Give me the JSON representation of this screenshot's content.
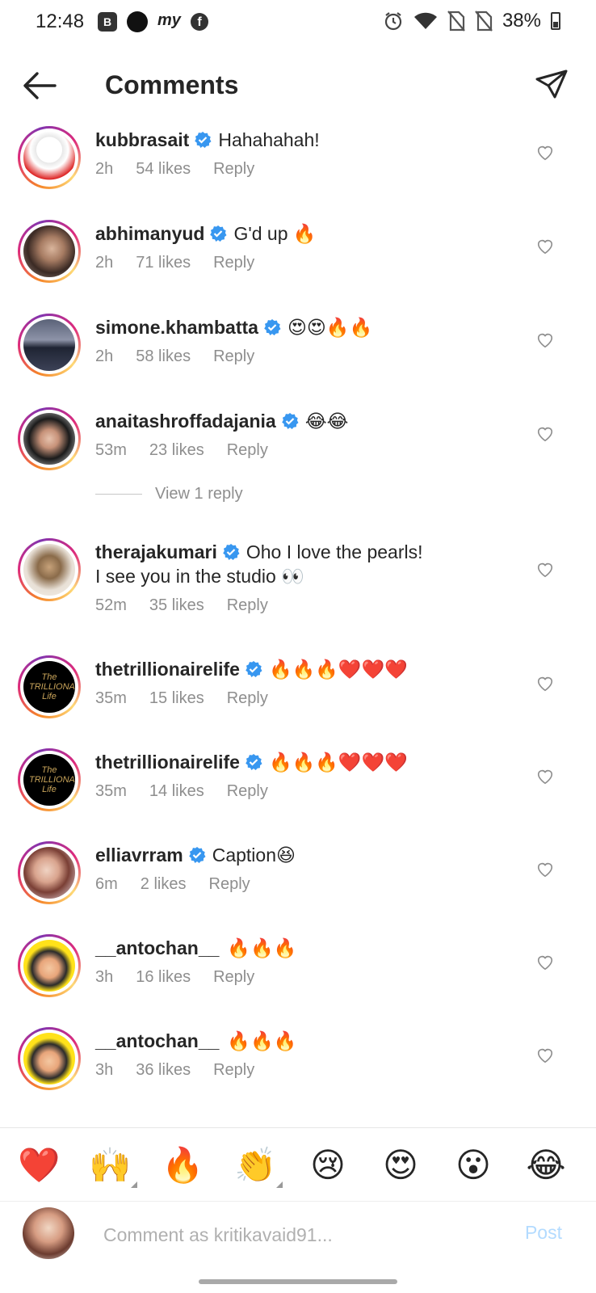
{
  "status_bar": {
    "time": "12:48",
    "b_badge": "B",
    "my_logo": "my",
    "fb_logo": "f",
    "battery": "38%"
  },
  "header": {
    "title": "Comments"
  },
  "comments": [
    {
      "username": "kubbrasait",
      "text": "Hahahahah!",
      "time": "2h",
      "likes": "54 likes",
      "reply": "Reply"
    },
    {
      "username": "abhimanyud",
      "text": "G'd up 🔥",
      "time": "2h",
      "likes": "71 likes",
      "reply": "Reply"
    },
    {
      "username": "simone.khambatta",
      "text": "😍😍🔥🔥",
      "time": "2h",
      "likes": "58 likes",
      "reply": "Reply"
    },
    {
      "username": "anaitashroffadajania",
      "text": "😂😂",
      "time": "53m",
      "likes": "23 likes",
      "reply": "Reply"
    },
    {
      "username": "therajakumari",
      "text": "Oho I love the pearls!",
      "text2": "I see you in the studio 👀",
      "time": "52m",
      "likes": "35 likes",
      "reply": "Reply"
    },
    {
      "username": "thetrillionairelife",
      "text": "🔥🔥🔥❤️❤️❤️",
      "time": "35m",
      "likes": "15 likes",
      "reply": "Reply"
    },
    {
      "username": "thetrillionairelife",
      "text": "🔥🔥🔥❤️❤️❤️",
      "time": "35m",
      "likes": "14 likes",
      "reply": "Reply"
    },
    {
      "username": "elliavrram",
      "text": "Caption😆",
      "time": "6m",
      "likes": "2 likes",
      "reply": "Reply"
    },
    {
      "username": "__antochan__",
      "text": "🔥🔥🔥",
      "time": "3h",
      "likes": "16 likes",
      "reply": "Reply"
    },
    {
      "username": "__antochan__",
      "text": "🔥🔥🔥",
      "time": "3h",
      "likes": "36 likes",
      "reply": "Reply"
    }
  ],
  "view_replies": "View 1 reply",
  "avatar_logo_text": "The TRILLIONAIRE Life",
  "emoji_bar": [
    "❤️",
    "🙌",
    "🔥",
    "👏",
    "😢",
    "😍",
    "😮",
    "😂"
  ],
  "composer": {
    "placeholder": "Comment as kritikavaid91...",
    "post_label": "Post"
  },
  "colors": {
    "verified_blue": "#3897f0",
    "muted_text": "#8e8e8e",
    "post_disabled": "#b3dbff"
  }
}
